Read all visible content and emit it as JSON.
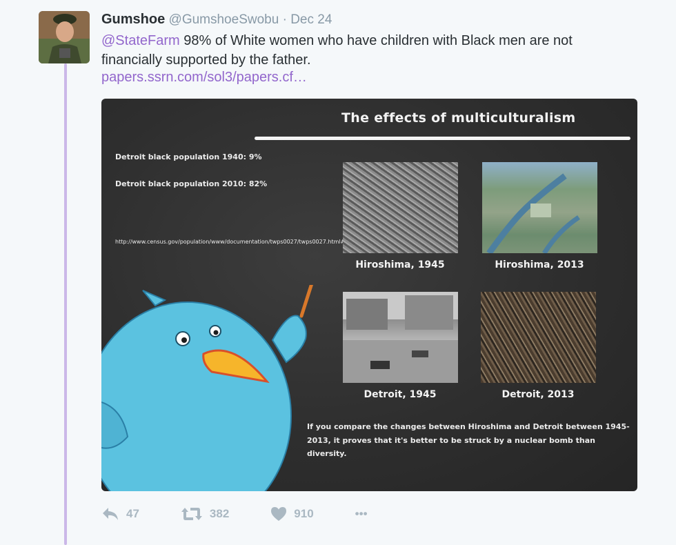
{
  "tweet": {
    "author_name": "Gumshoe",
    "author_handle": "@GumshoeSwobu",
    "separator": "·",
    "date": "Dec 24",
    "mention": "@StateFarm",
    "text": " 98% of White women who have children with Black men are not financially supported by the father.",
    "link": "papers.ssrn.com/sol3/papers.cf…"
  },
  "media": {
    "title": "The effects of multiculturalism",
    "stat_1940": "Detroit black population 1940: 9%",
    "stat_2010": "Detroit black population 2010: 82%",
    "source_url": "http://www.census.gov/population/www/documentation/twps0027/twps0027.html#cities",
    "captions": [
      "Hiroshima, 1945",
      "Hiroshima, 2013",
      "Detroit, 1945",
      "Detroit, 2013"
    ],
    "conclusion": "If you compare the changes between Hiroshima and Detroit between 1945-2013, it proves that it's better to be struck by a nuclear bomb than diversity."
  },
  "actions": {
    "reply_count": "47",
    "retweet_count": "382",
    "like_count": "910",
    "more_label": "•••"
  },
  "icons": {
    "reply": "reply-icon",
    "retweet": "retweet-icon",
    "like": "heart-icon",
    "more": "more-icon"
  },
  "colors": {
    "link": "#9266cc",
    "thread_line": "#cbb7e8",
    "action_gray": "#aab8c2",
    "chalkboard": "#2e2e2e",
    "bird_blue": "#5bc2e0",
    "beak": "#f6b52b"
  }
}
